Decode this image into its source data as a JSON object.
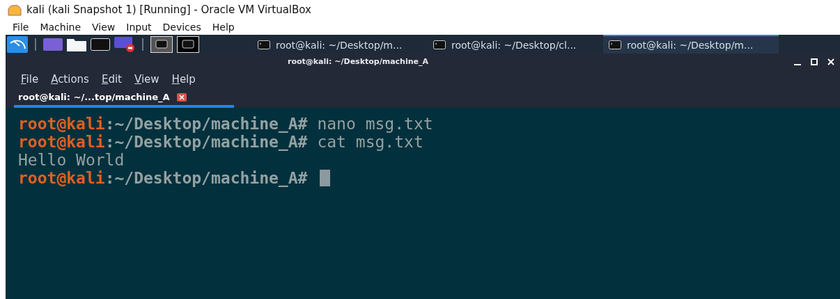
{
  "window": {
    "title": "kali (kali Snapshot 1) [Running] - Oracle VM VirtualBox"
  },
  "menu": [
    "File",
    "Machine",
    "View",
    "Input",
    "Devices",
    "Help"
  ],
  "panel": {
    "tasks": [
      {
        "label": "root@kali: ~/Desktop/m...",
        "selected": false
      },
      {
        "label": "root@kali: ~/Desktop/cl...",
        "selected": false
      },
      {
        "label": "root@kali: ~/Desktop/m...",
        "selected": true
      }
    ]
  },
  "terminal": {
    "title": "root@kali: ~/Desktop/machine_A",
    "menu": [
      "File",
      "Actions",
      "Edit",
      "View",
      "Help"
    ],
    "tab": {
      "label": "root@kali: ~/...top/machine_A",
      "selected": true
    },
    "lines": [
      {
        "kind": "prompt",
        "user": "root@kali",
        "path": ":~/Desktop/machine_A#",
        "command": "nano msg.txt"
      },
      {
        "kind": "prompt",
        "user": "root@kali",
        "path": ":~/Desktop/machine_A#",
        "command": "cat msg.txt"
      },
      {
        "kind": "output",
        "text": "Hello World"
      },
      {
        "kind": "prompt",
        "user": "root@kali",
        "path": ":~/Desktop/machine_A#",
        "cursor": true
      }
    ]
  }
}
